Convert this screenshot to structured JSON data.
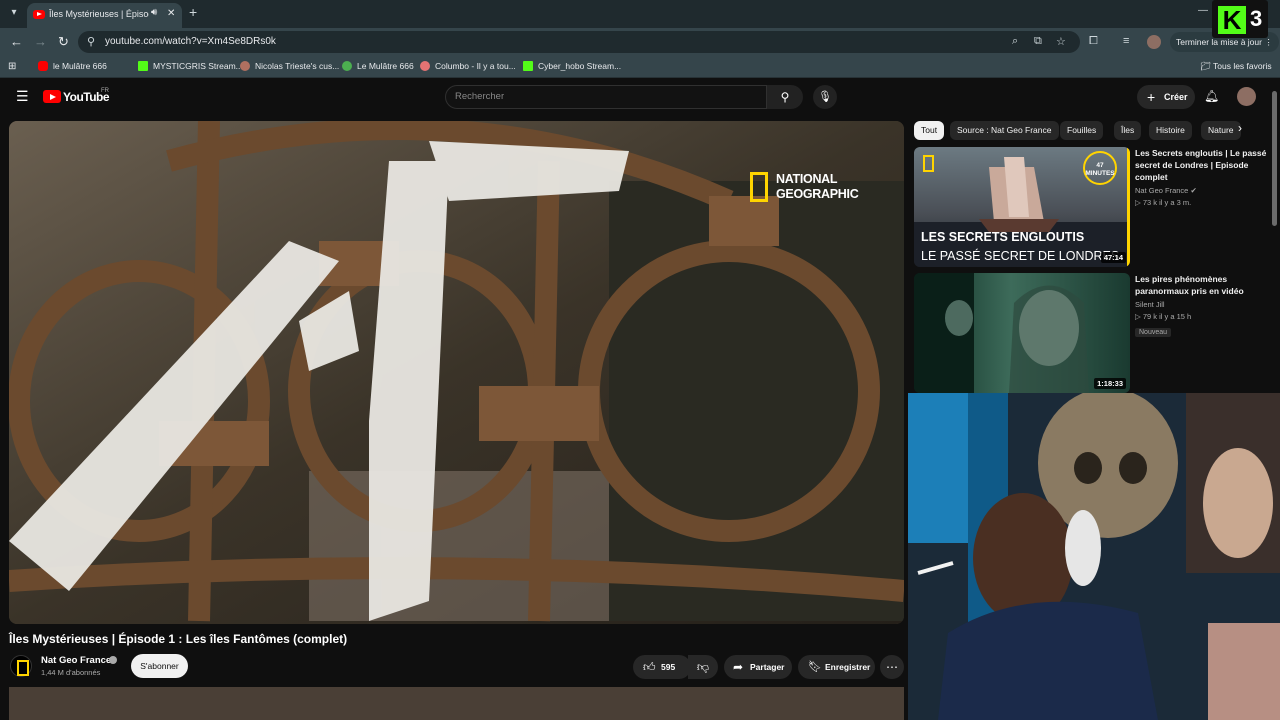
{
  "browser": {
    "tab_title": "Îles Mystérieuses | Épisode",
    "url": "youtube.com/watch?v=Xm4Se8DRs0k",
    "update_label": "Terminer la mise à jour",
    "bookmarks": [
      "le Mulâtre 666",
      "MYSTICGRIS Stream...",
      "Nicolas Trieste's cus...",
      "Le Mulâtre 666",
      "Columbo - Il y a tou...",
      "Cyber_hobo Stream..."
    ],
    "all_favorites": "Tous les favoris"
  },
  "overlay": {
    "logo_letter": "K",
    "logo_number": "3"
  },
  "youtube": {
    "logo_text": "YouTube",
    "region": "FR",
    "search_placeholder": "Rechercher",
    "create_label": "Créer"
  },
  "video": {
    "watermark_line1": "NATIONAL",
    "watermark_line2": "GEOGRAPHIC",
    "title": "Îles Mystérieuses | Épisode 1 : Les îles Fantômes (complet)",
    "channel": "Nat Geo France",
    "subscribers": "1,44 M d'abonnés",
    "subscribe_label": "S'abonner",
    "likes": "595",
    "share_label": "Partager",
    "save_label": "Enregistrer"
  },
  "sidebar": {
    "chips": [
      "Tout",
      "Source : Nat Geo France",
      "Fouilles",
      "Îles",
      "Histoire",
      "Nature"
    ],
    "videos": [
      {
        "title": "Les Secrets engloutis | Le passé secret de Londres | Episode complet",
        "channel": "Nat Geo France",
        "meta": "▷ 73 k  il y a 3 m.",
        "duration": "47:14",
        "thumb_line1": "LES SECRETS ENGLOUTIS",
        "thumb_line2": "LE PASSÉ SECRET DE LONDRES",
        "thumb_badge_num": "47",
        "thumb_badge_unit": "MINUTES"
      },
      {
        "title": "Les pires phénomènes paranormaux pris en vidéo",
        "channel": "Silent Jill",
        "meta": "▷ 79 k  il y a 15 h",
        "badge": "Nouveau",
        "duration": "1:18:33"
      }
    ]
  }
}
